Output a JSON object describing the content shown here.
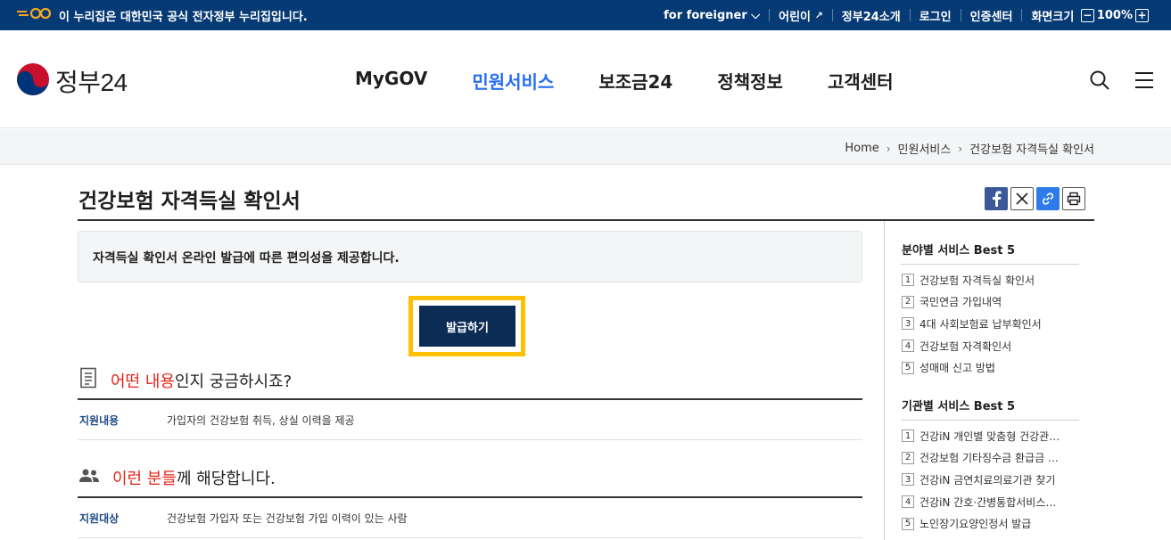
{
  "topbar": {
    "official_notice": "이 누리집은 대한민국 공식 전자정부 누리집입니다.",
    "foreigner": "for foreigner",
    "kids": "어린이",
    "about": "정부24소개",
    "login": "로그인",
    "cert": "인증센터",
    "zoom_label": "화면크기",
    "zoom_value": "100%",
    "minus": "−",
    "plus": "+"
  },
  "header": {
    "logo_text": "정부24",
    "nav": [
      "MyGOV",
      "민원서비스",
      "보조금24",
      "정책정보",
      "고객센터"
    ],
    "active_nav": "민원서비스"
  },
  "breadcrumb": [
    "Home",
    "민원서비스",
    "건강보험 자격득실 확인서"
  ],
  "page": {
    "title": "건강보험 자격득실 확인서",
    "notice": "자격득실 확인서 온라인 발급에 따른 편의성을 제공합니다.",
    "issue_button": "발급하기",
    "section1": {
      "highlight": "어떤 내용",
      "rest": "인지 궁금하시죠?"
    },
    "support_key": "지원내용",
    "support_value": "가입자의 건강보험 취득, 상실 이력을 제공",
    "section2": {
      "highlight": "이런 분들",
      "rest": "께 해당합니다."
    },
    "target_key": "지원대상",
    "target_value": "건강보험 가입자 또는 건강보험 가입 이력이 있는 사람"
  },
  "sidebar": {
    "field_title": "분야별 서비스 Best 5",
    "field_items": [
      {
        "num": "1",
        "label": "건강보험 자격득실 확인서"
      },
      {
        "num": "2",
        "label": "국민연금 가입내역"
      },
      {
        "num": "3",
        "label": "4대 사회보험료 납부확인서"
      },
      {
        "num": "4",
        "label": "건강보험 자격확인서"
      },
      {
        "num": "5",
        "label": "성매매 신고 방법"
      }
    ],
    "agency_title": "기관별 서비스 Best 5",
    "agency_items": [
      {
        "num": "1",
        "label": "건강iN 개인별 맞춤형 건강관…"
      },
      {
        "num": "2",
        "label": "건강보험 기타징수금 환급금 …"
      },
      {
        "num": "3",
        "label": "건강iN 금연치료의료기관 찾기"
      },
      {
        "num": "4",
        "label": "건강iN 간호·간병통합서비스…"
      },
      {
        "num": "5",
        "label": "노인장기요양인정서 발급"
      }
    ]
  },
  "colors": {
    "brand_navy": "#063a74",
    "accent_blue": "#256ef4",
    "highlight_red": "#e1251b",
    "focus_yellow": "#ffc000"
  }
}
